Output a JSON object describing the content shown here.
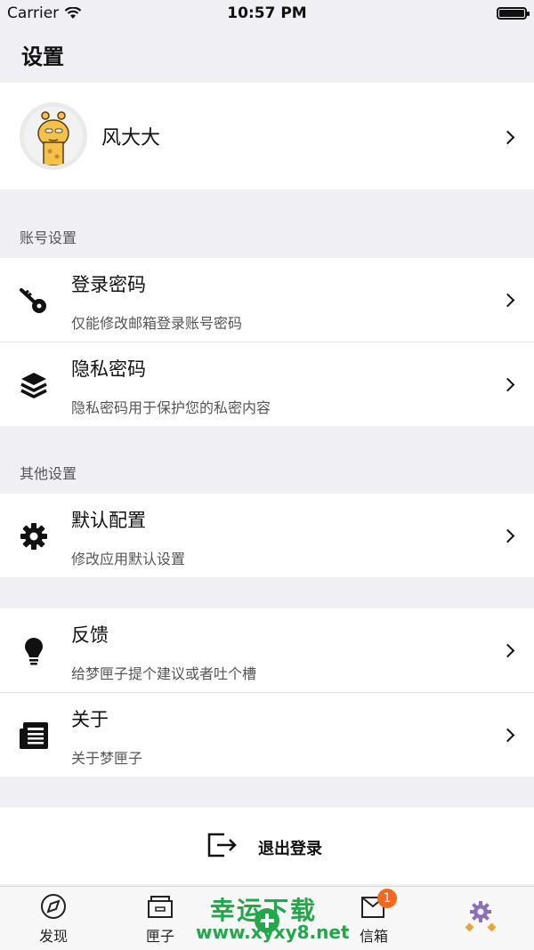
{
  "status_bar": {
    "carrier": "Carrier",
    "time": "10:57 PM"
  },
  "page": {
    "title": "设置"
  },
  "profile": {
    "name": "风大大"
  },
  "groups": {
    "account": {
      "label": "账号设置",
      "rows": [
        {
          "title": "登录密码",
          "subtitle": "仅能修改邮箱登录账号密码",
          "icon": "key-icon"
        },
        {
          "title": "隐私密码",
          "subtitle": "隐私密码用于保护您的私密内容",
          "icon": "layers-icon"
        }
      ]
    },
    "other": {
      "label": "其他设置",
      "rows": [
        {
          "title": "默认配置",
          "subtitle": "修改应用默认设置",
          "icon": "gear-icon"
        }
      ]
    },
    "more": {
      "rows": [
        {
          "title": "反馈",
          "subtitle": "给梦匣子提个建议或者吐个槽",
          "icon": "lightbulb-icon"
        },
        {
          "title": "关于",
          "subtitle": "关于梦匣子",
          "icon": "newspaper-icon"
        }
      ]
    }
  },
  "logout": {
    "label": "退出登录",
    "icon": "logout-icon"
  },
  "tabbar": {
    "tabs": [
      {
        "label": "发现",
        "icon": "compass-icon"
      },
      {
        "label": "匣子",
        "icon": "box-icon"
      },
      {
        "label": "",
        "icon": "plus-icon"
      },
      {
        "label": "信箱",
        "icon": "mailbox-icon",
        "badge": "1"
      },
      {
        "label": "",
        "icon": "settings-gear-icon"
      }
    ]
  },
  "watermark": {
    "line1": "幸运下载",
    "line2": "www.xyxy8.net"
  },
  "colors": {
    "badge": "#f06a1d",
    "watermark": "#22a84a",
    "background": "#efeff4"
  }
}
